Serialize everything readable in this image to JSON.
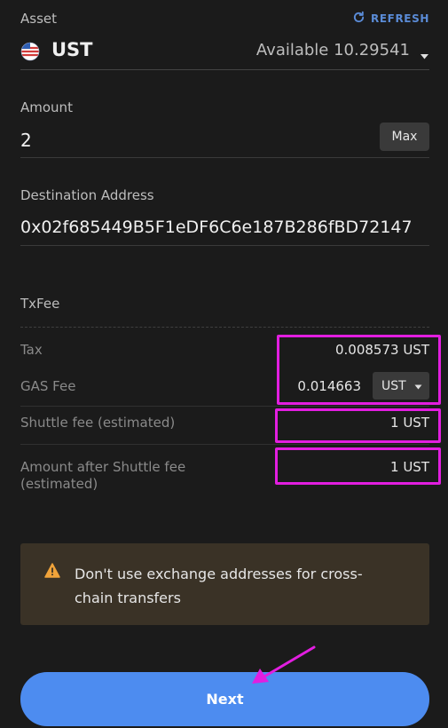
{
  "asset": {
    "label": "Asset",
    "refresh_label": "REFRESH",
    "token": "UST",
    "available_text": "Available 10.29541",
    "flag_icon": "us-flag-icon"
  },
  "amount": {
    "label": "Amount",
    "value": "2",
    "max_label": "Max"
  },
  "destination": {
    "label": "Destination Address",
    "value": "0x02f685449B5F1eDF6C6e187B286fBD72147"
  },
  "txfee": {
    "label": "TxFee",
    "tax_label": "Tax",
    "tax_value": "0.008573 UST",
    "gas_label": "GAS Fee",
    "gas_value": "0.014663",
    "gas_currency": "UST",
    "shuttle_label": "Shuttle fee (estimated)",
    "shuttle_value": "1 UST",
    "after_label_line1": "Amount after Shuttle fee",
    "after_label_line2": "(estimated)",
    "after_value": "1 UST"
  },
  "warning": {
    "line1": "Don't use exchange addresses for cross-",
    "line2": "chain transfers"
  },
  "next_label": "Next",
  "colors": {
    "background": "#1b1b1b",
    "accent": "#4d8cf0",
    "refresh": "#5a8bd6",
    "highlight": "#e21ee0",
    "warning_bg": "#3a3226",
    "warning_icon": "#f0a33a"
  }
}
